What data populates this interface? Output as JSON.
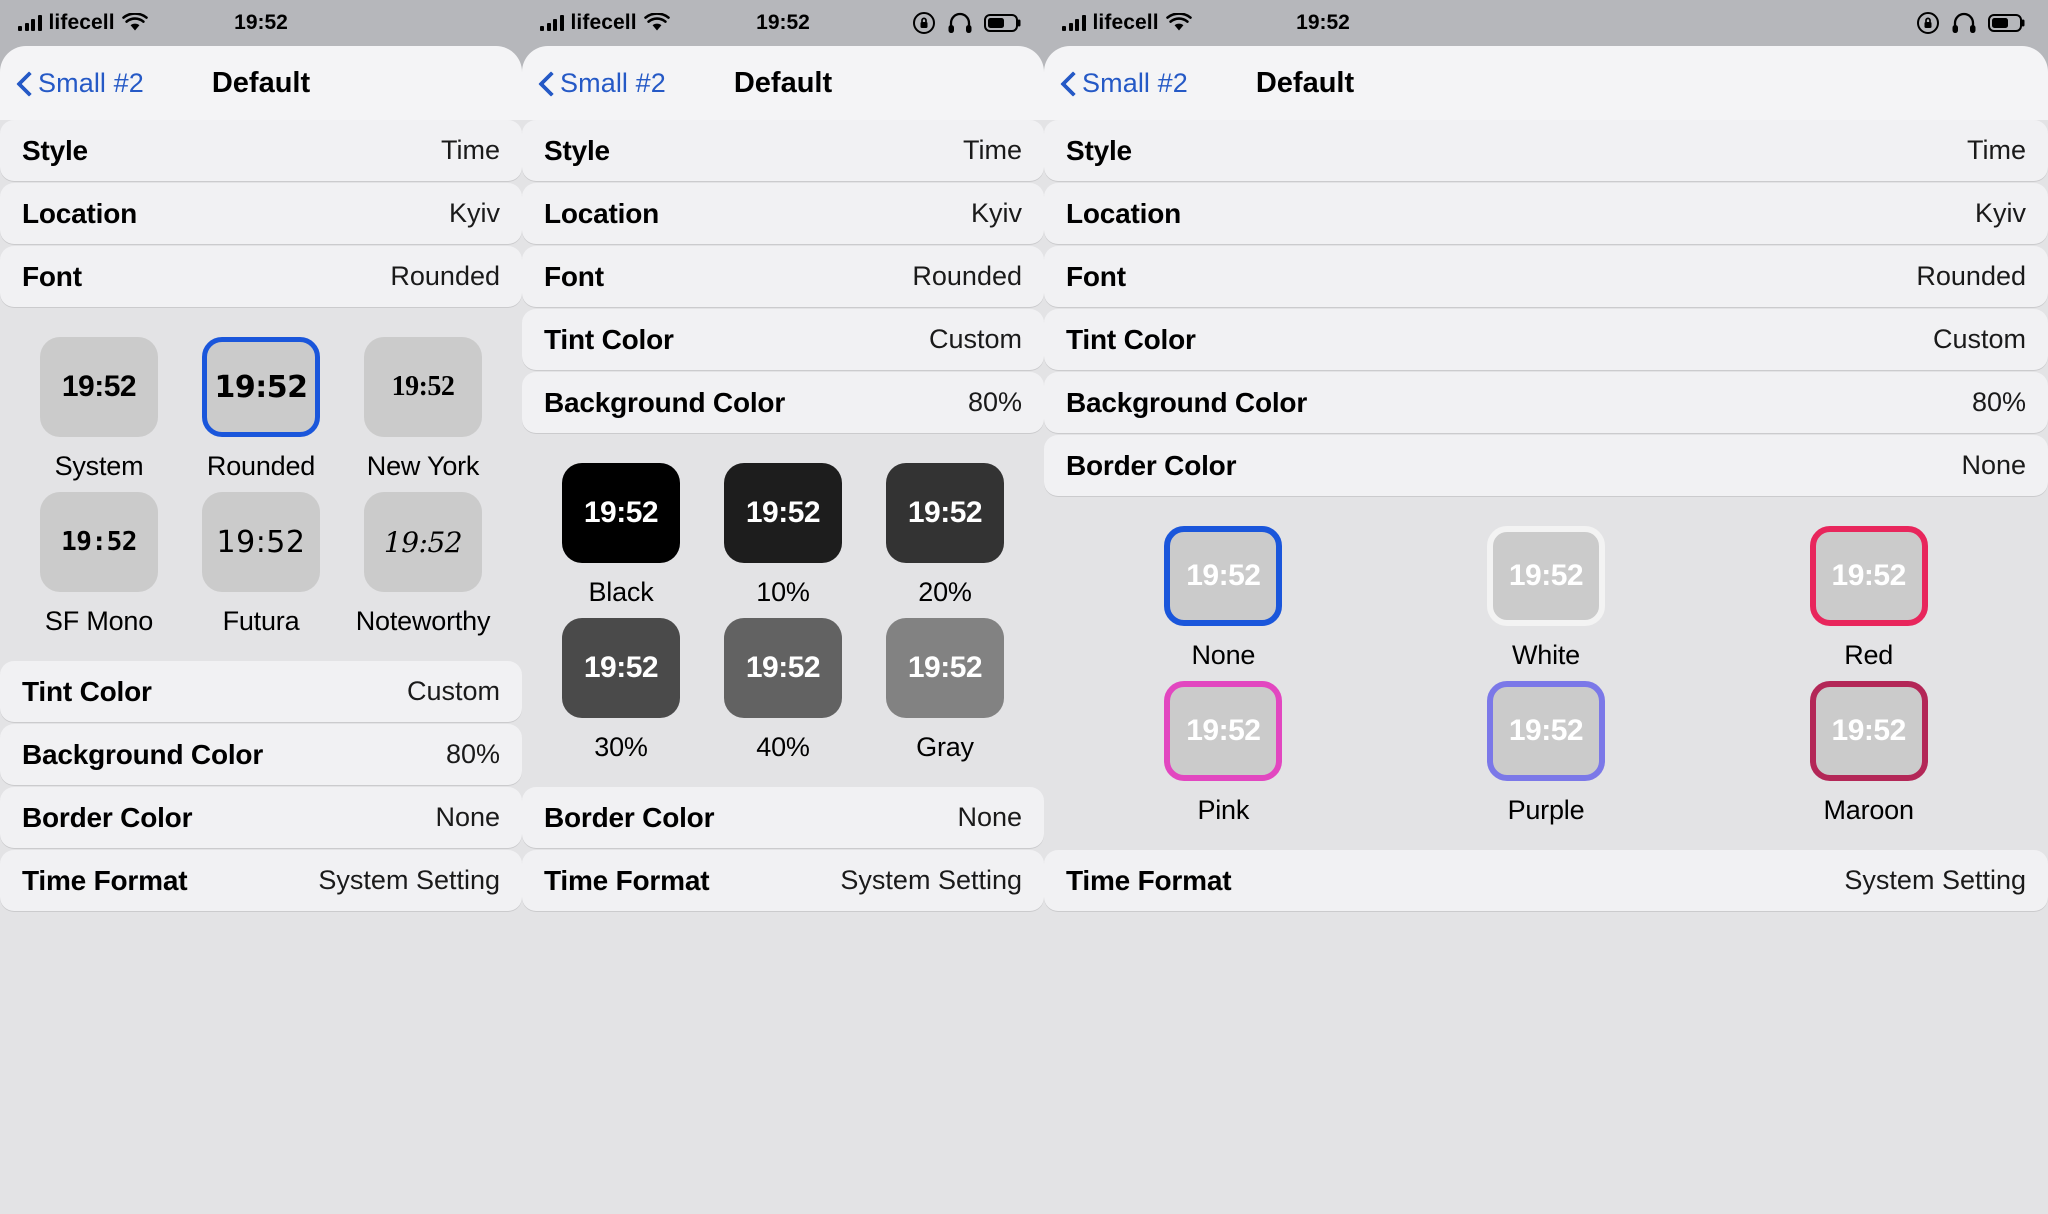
{
  "statusbar": {
    "carrier": "lifecell",
    "time": "19:52",
    "icons": [
      "signal-bars-icon",
      "wifi-icon",
      "rotation-lock-icon",
      "headphones-icon",
      "battery-icon"
    ]
  },
  "nav": {
    "back_label": "Small #2",
    "title": "Default"
  },
  "rows": {
    "style": {
      "label": "Style",
      "value": "Time"
    },
    "location": {
      "label": "Location",
      "value": "Kyiv"
    },
    "font": {
      "label": "Font",
      "value": "Rounded"
    },
    "tint": {
      "label": "Tint Color",
      "value": "Custom"
    },
    "background": {
      "label": "Background Color",
      "value": "80%"
    },
    "border": {
      "label": "Border Color",
      "value": "None"
    },
    "timeformat": {
      "label": "Time Format",
      "value": "System Setting"
    }
  },
  "font_grid": {
    "time_sample": "19:52",
    "selected": "Rounded",
    "options": [
      {
        "label": "System",
        "face": "f-system",
        "selected": false
      },
      {
        "label": "Rounded",
        "face": "f-rounded",
        "selected": true
      },
      {
        "label": "New York",
        "face": "f-newyork",
        "selected": false
      },
      {
        "label": "SF Mono",
        "face": "f-mono",
        "selected": false
      },
      {
        "label": "Futura",
        "face": "f-futura",
        "selected": false
      },
      {
        "label": "Noteworthy",
        "face": "f-note",
        "selected": false
      }
    ]
  },
  "background_grid": {
    "time_sample": "19:52",
    "options": [
      {
        "label": "Black",
        "color": "#000000"
      },
      {
        "label": "10%",
        "color": "#1d1d1d"
      },
      {
        "label": "20%",
        "color": "#333333"
      },
      {
        "label": "30%",
        "color": "#4a4a4a"
      },
      {
        "label": "40%",
        "color": "#626262"
      },
      {
        "label": "Gray",
        "color": "#828282"
      }
    ]
  },
  "border_grid": {
    "time_sample": "19:52",
    "tile_fill": "#cbcbcb",
    "selected": "None",
    "options": [
      {
        "label": "None",
        "color": "#1a56db",
        "selected": true
      },
      {
        "label": "White",
        "color": "#f3f3f3",
        "selected": false
      },
      {
        "label": "Red",
        "color": "#e8265c",
        "selected": false
      },
      {
        "label": "Pink",
        "color": "#e247c0",
        "selected": false
      },
      {
        "label": "Purple",
        "color": "#7b78e8",
        "selected": false
      },
      {
        "label": "Maroon",
        "color": "#b32757",
        "selected": false
      }
    ]
  },
  "panels": [
    {
      "name": "font-picker-panel",
      "expanded": "font"
    },
    {
      "name": "background-picker-panel",
      "expanded": "background"
    },
    {
      "name": "border-picker-panel",
      "expanded": "border"
    }
  ]
}
